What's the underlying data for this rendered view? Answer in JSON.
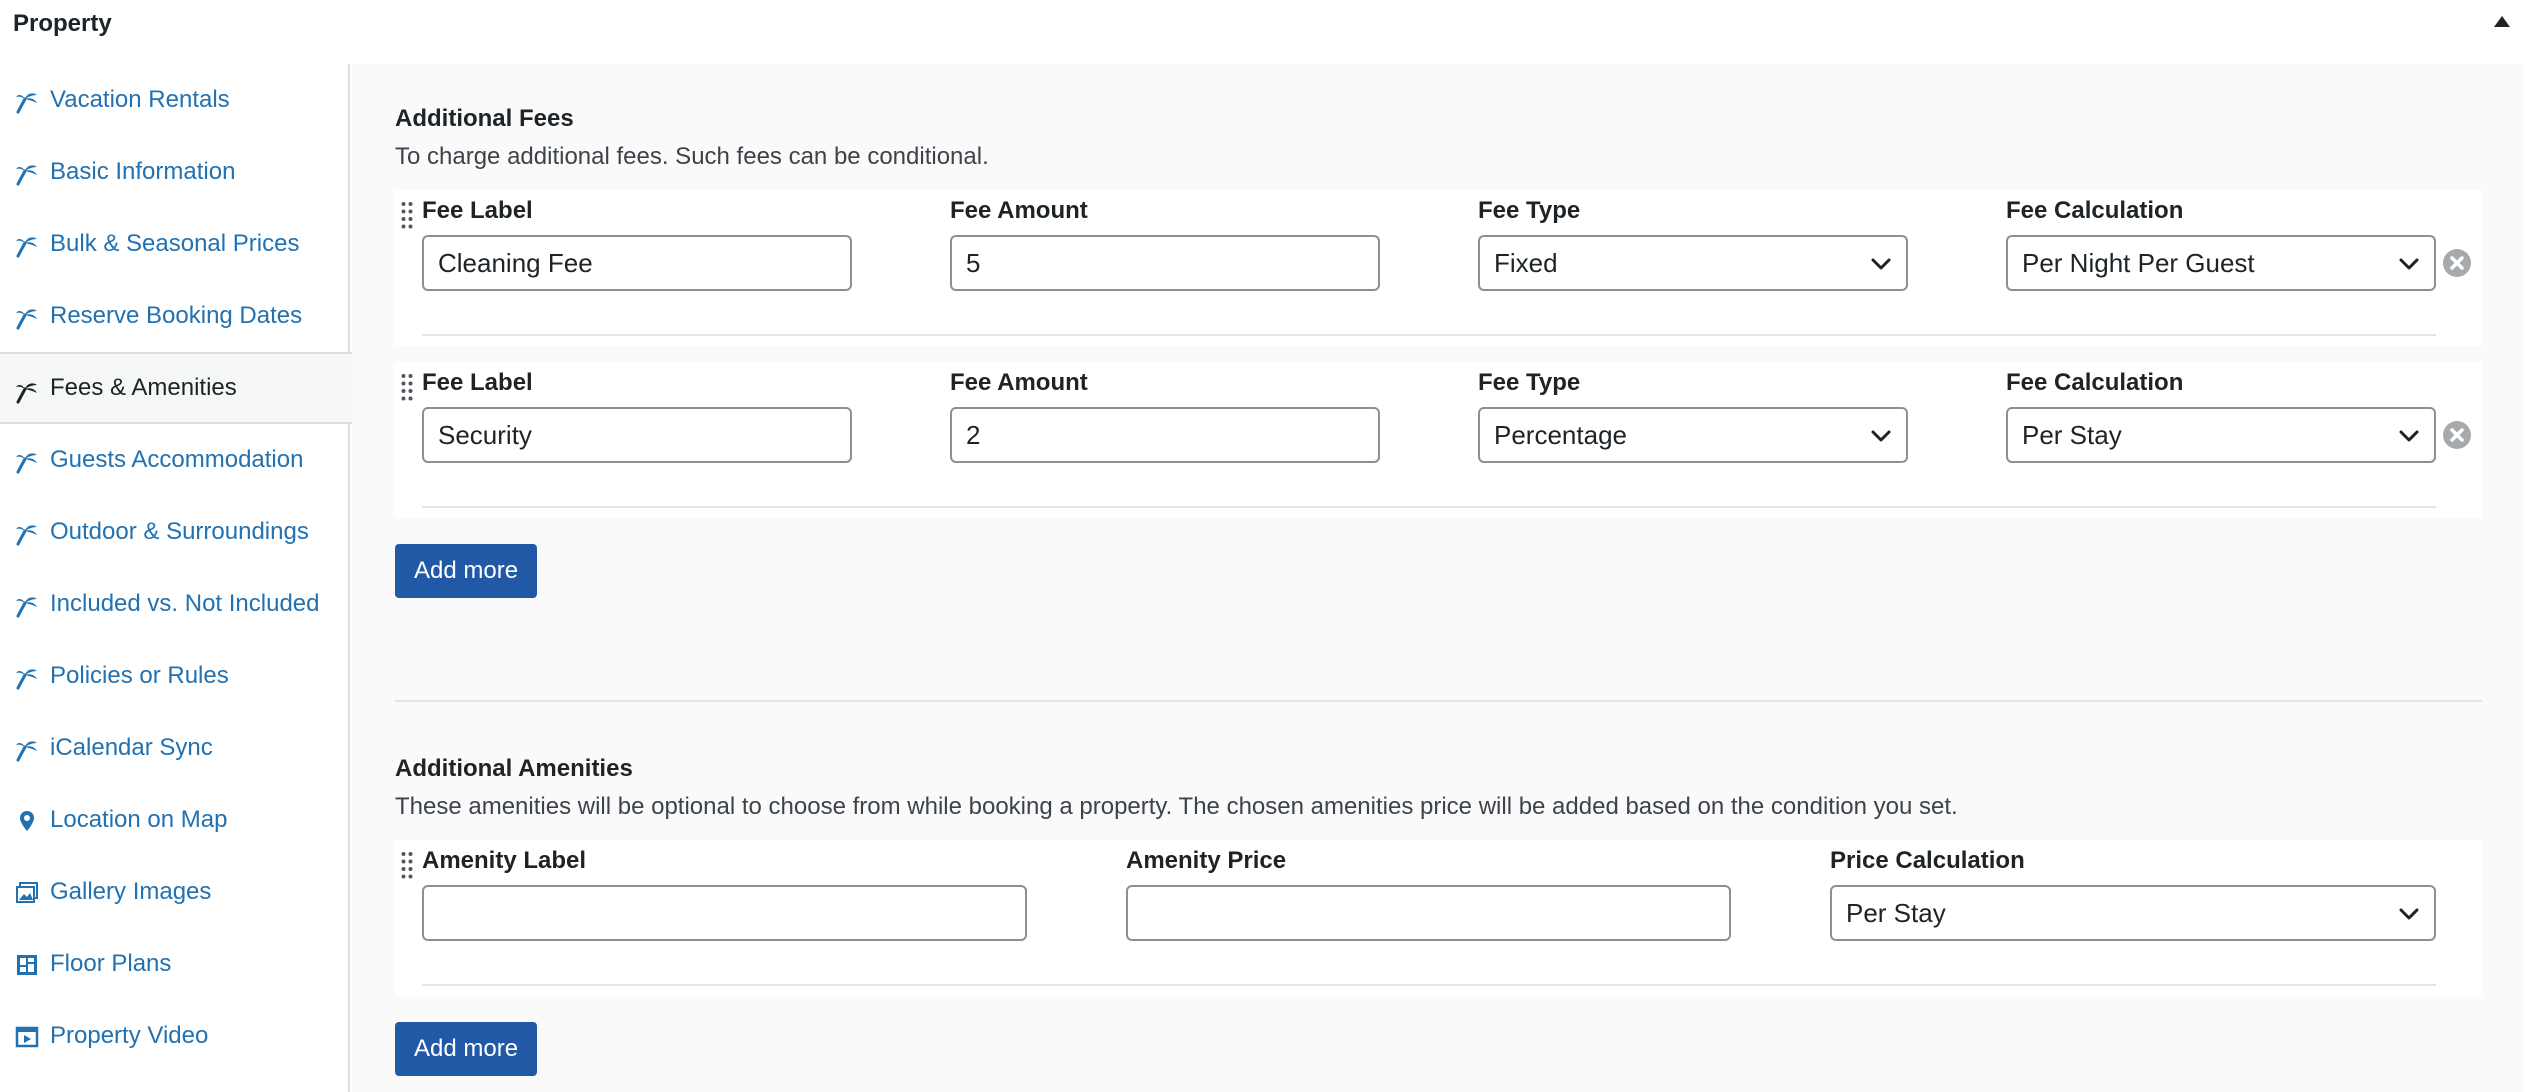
{
  "header": {
    "title": "Property"
  },
  "sidebar": {
    "items": [
      {
        "label": "Vacation Rentals",
        "icon": "palm-tree-icon"
      },
      {
        "label": "Basic Information",
        "icon": "palm-tree-icon"
      },
      {
        "label": "Bulk & Seasonal Prices",
        "icon": "palm-tree-icon"
      },
      {
        "label": "Reserve Booking Dates",
        "icon": "palm-tree-icon"
      },
      {
        "label": "Fees & Amenities",
        "icon": "palm-tree-icon",
        "active": true
      },
      {
        "label": "Guests Accommodation",
        "icon": "palm-tree-icon"
      },
      {
        "label": "Outdoor & Surroundings",
        "icon": "palm-tree-icon"
      },
      {
        "label": "Included vs. Not Included",
        "icon": "palm-tree-icon"
      },
      {
        "label": "Policies or Rules",
        "icon": "palm-tree-icon"
      },
      {
        "label": "iCalendar Sync",
        "icon": "palm-tree-icon"
      },
      {
        "label": "Location on Map",
        "icon": "map-pin-icon"
      },
      {
        "label": "Gallery Images",
        "icon": "gallery-icon"
      },
      {
        "label": "Floor Plans",
        "icon": "floor-plan-icon"
      },
      {
        "label": "Property Video",
        "icon": "video-icon"
      }
    ]
  },
  "fees": {
    "title": "Additional Fees",
    "description": "To charge additional fees. Such fees can be conditional.",
    "rows": [
      {
        "label_title": "Fee Label",
        "label_value": "Cleaning Fee",
        "amount_title": "Fee Amount",
        "amount_value": "5",
        "type_title": "Fee Type",
        "type_value": "Fixed",
        "calc_title": "Fee Calculation",
        "calc_value": "Per Night Per Guest"
      },
      {
        "label_title": "Fee Label",
        "label_value": "Security",
        "amount_title": "Fee Amount",
        "amount_value": "2",
        "type_title": "Fee Type",
        "type_value": "Percentage",
        "calc_title": "Fee Calculation",
        "calc_value": "Per Stay"
      }
    ],
    "add_button": "Add more"
  },
  "amenities": {
    "title": "Additional Amenities",
    "description": "These amenities will be optional to choose from while booking a property. The chosen amenities price will be added based on the condition you set.",
    "rows": [
      {
        "label_title": "Amenity Label",
        "label_value": "",
        "price_title": "Amenity Price",
        "price_value": "",
        "calc_title": "Price Calculation",
        "calc_value": "Per Stay"
      }
    ],
    "add_button": "Add more"
  },
  "colors": {
    "link": "#2271b1",
    "button": "#2259a6",
    "text": "#1d2327"
  }
}
